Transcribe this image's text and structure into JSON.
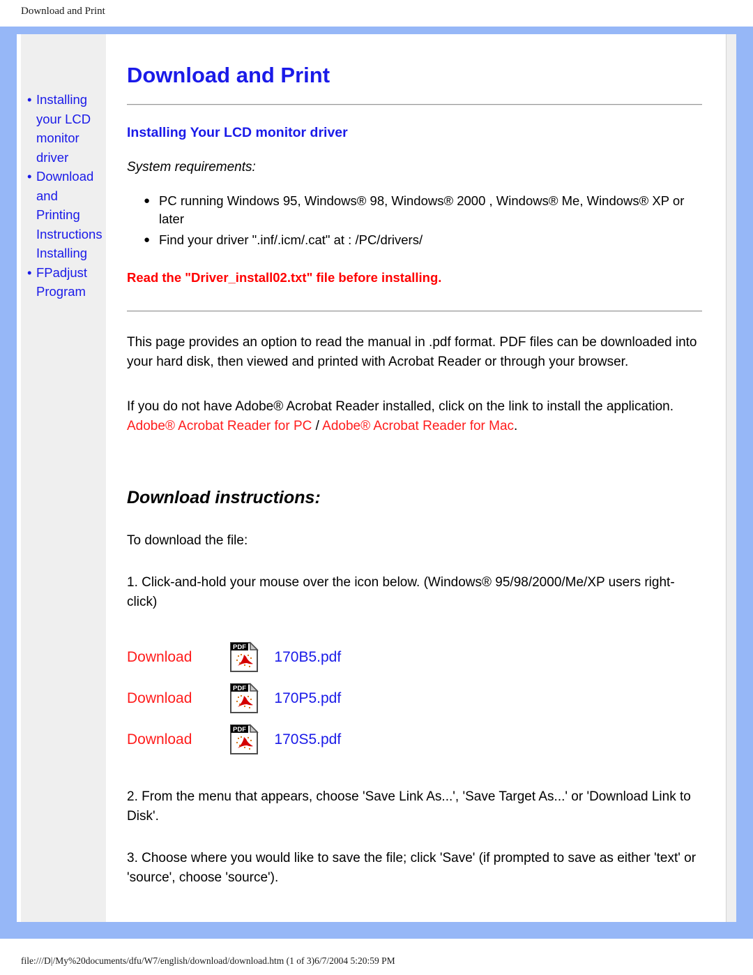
{
  "print": {
    "header": "Download and Print",
    "footer": "file:///D|/My%20documents/dfu/W7/english/download/download.htm (1 of 3)6/7/2004 5:20:59 PM"
  },
  "colors": {
    "frame_blue": "#96b7f7",
    "sidebar_gray": "#efefef",
    "link_blue": "#1a1ae8",
    "link_red": "#ff1c1c",
    "warning_red": "#ff0000"
  },
  "sidebar": {
    "items": [
      {
        "bullet": "•",
        "label": "Installing your LCD monitor driver"
      },
      {
        "bullet": "•",
        "label": "Download and Printing Instructions Installing"
      },
      {
        "bullet": "•",
        "label": "FPadjust Program"
      }
    ]
  },
  "main": {
    "page_title": "Download and Print",
    "section_title": "Installing Your LCD monitor driver",
    "sysreq_label": "System requirements:",
    "requirements": [
      "PC running Windows 95, Windows® 98, Windows® 2000 , Windows® Me, Windows® XP or later",
      "Find your driver \".inf/.icm/.cat\" at : /PC/drivers/"
    ],
    "warning": "Read the \"Driver_install02.txt\" file before installing.",
    "intro_paragraph": "This page provides an option to read the manual in .pdf format. PDF files can be downloaded into your hard disk, then viewed and printed with Acrobat Reader or through your browser.",
    "acrobat_paragraph": "If you do not have Adobe® Acrobat Reader installed, click on the link to install the application.",
    "acrobat_link_pc": "Adobe® Acrobat Reader for PC",
    "acrobat_link_separator": " / ",
    "acrobat_link_mac": "Adobe® Acrobat Reader for Mac",
    "acrobat_link_period": ".",
    "download_instructions_title": "Download instructions:",
    "to_download": "To download the file:",
    "step1": "1. Click-and-hold your mouse over the icon below. (Windows® 95/98/2000/Me/XP users right-click)",
    "step2": "2. From the menu that appears, choose 'Save Link As...', 'Save Target As...' or 'Download Link to Disk'.",
    "step3": "3. Choose where you would like to save the file; click 'Save' (if prompted to save as either 'text' or 'source', choose 'source').",
    "downloads": [
      {
        "action": "Download",
        "icon": "pdf-file-icon",
        "filename": "170B5.pdf"
      },
      {
        "action": "Download",
        "icon": "pdf-file-icon",
        "filename": "170P5.pdf"
      },
      {
        "action": "Download",
        "icon": "pdf-file-icon",
        "filename": "170S5.pdf"
      }
    ]
  }
}
